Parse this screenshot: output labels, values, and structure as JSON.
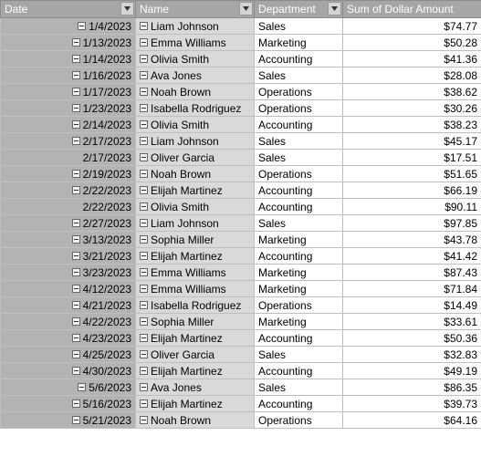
{
  "headers": {
    "date": "Date",
    "name": "Name",
    "department": "Department",
    "amount": "Sum of Dollar Amount"
  },
  "rows": [
    {
      "date": "1/4/2023",
      "collapsible": true,
      "name": "Liam Johnson",
      "department": "Sales",
      "amount": "$74.77"
    },
    {
      "date": "1/13/2023",
      "collapsible": true,
      "name": "Emma Williams",
      "department": "Marketing",
      "amount": "$50.28"
    },
    {
      "date": "1/14/2023",
      "collapsible": true,
      "name": "Olivia Smith",
      "department": "Accounting",
      "amount": "$41.36"
    },
    {
      "date": "1/16/2023",
      "collapsible": true,
      "name": "Ava Jones",
      "department": "Sales",
      "amount": "$28.08"
    },
    {
      "date": "1/17/2023",
      "collapsible": true,
      "name": "Noah Brown",
      "department": "Operations",
      "amount": "$38.62"
    },
    {
      "date": "1/23/2023",
      "collapsible": true,
      "name": "Isabella Rodriguez",
      "department": "Operations",
      "amount": "$30.26"
    },
    {
      "date": "2/14/2023",
      "collapsible": true,
      "name": "Olivia Smith",
      "department": "Accounting",
      "amount": "$38.23"
    },
    {
      "date": "2/17/2023",
      "collapsible": true,
      "name": "Liam Johnson",
      "department": "Sales",
      "amount": "$45.17"
    },
    {
      "date": "2/17/2023",
      "collapsible": false,
      "name": "Oliver Garcia",
      "department": "Sales",
      "amount": "$17.51"
    },
    {
      "date": "2/19/2023",
      "collapsible": true,
      "name": "Noah Brown",
      "department": "Operations",
      "amount": "$51.65"
    },
    {
      "date": "2/22/2023",
      "collapsible": true,
      "name": "Elijah Martinez",
      "department": "Accounting",
      "amount": "$66.19"
    },
    {
      "date": "2/22/2023",
      "collapsible": false,
      "name": "Olivia Smith",
      "department": "Accounting",
      "amount": "$90.11"
    },
    {
      "date": "2/27/2023",
      "collapsible": true,
      "name": "Liam Johnson",
      "department": "Sales",
      "amount": "$97.85"
    },
    {
      "date": "3/13/2023",
      "collapsible": true,
      "name": "Sophia Miller",
      "department": "Marketing",
      "amount": "$43.78"
    },
    {
      "date": "3/21/2023",
      "collapsible": true,
      "name": "Elijah Martinez",
      "department": "Accounting",
      "amount": "$41.42"
    },
    {
      "date": "3/23/2023",
      "collapsible": true,
      "name": "Emma Williams",
      "department": "Marketing",
      "amount": "$87.43"
    },
    {
      "date": "4/12/2023",
      "collapsible": true,
      "name": "Emma Williams",
      "department": "Marketing",
      "amount": "$71.84"
    },
    {
      "date": "4/21/2023",
      "collapsible": true,
      "name": "Isabella Rodriguez",
      "department": "Operations",
      "amount": "$14.49"
    },
    {
      "date": "4/22/2023",
      "collapsible": true,
      "name": "Sophia Miller",
      "department": "Marketing",
      "amount": "$33.61"
    },
    {
      "date": "4/23/2023",
      "collapsible": true,
      "name": "Elijah Martinez",
      "department": "Accounting",
      "amount": "$50.36"
    },
    {
      "date": "4/25/2023",
      "collapsible": true,
      "name": "Oliver Garcia",
      "department": "Sales",
      "amount": "$32.83"
    },
    {
      "date": "4/30/2023",
      "collapsible": true,
      "name": "Elijah Martinez",
      "department": "Accounting",
      "amount": "$49.19"
    },
    {
      "date": "5/6/2023",
      "collapsible": true,
      "name": "Ava Jones",
      "department": "Sales",
      "amount": "$86.35"
    },
    {
      "date": "5/16/2023",
      "collapsible": true,
      "name": "Elijah Martinez",
      "department": "Accounting",
      "amount": "$39.73"
    },
    {
      "date": "5/21/2023",
      "collapsible": true,
      "name": "Noah Brown",
      "department": "Operations",
      "amount": "$64.16"
    }
  ]
}
